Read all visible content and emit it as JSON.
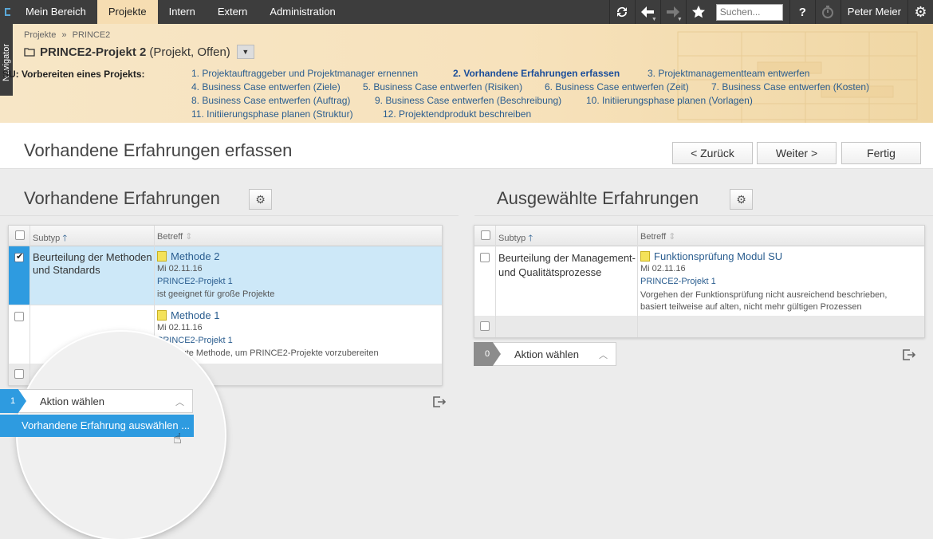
{
  "topbar": {
    "tabs": [
      "Mein Bereich",
      "Projekte",
      "Intern",
      "Extern",
      "Administration"
    ],
    "active_tab": "Projekte",
    "search_placeholder": "Suchen...",
    "help": "?",
    "user": "Peter Meier"
  },
  "navigator": "Navigator",
  "breadcrumb": {
    "a": "Projekte",
    "sep": "»",
    "b": "PRINCE2"
  },
  "project": {
    "name": "PRINCE2-Projekt 2",
    "status": "(Projekt, Offen)"
  },
  "su": {
    "label": "SU: Vorbereiten eines Projekts:",
    "steps": [
      "1. Projektauftraggeber und Projektmanager ernennen",
      "2. Vorhandene Erfahrungen erfassen",
      "3. Projektmanagementteam entwerfen",
      "4. Business Case entwerfen (Ziele)",
      "5. Business Case entwerfen (Risiken)",
      "6. Business Case entwerfen (Zeit)",
      "7. Business Case entwerfen (Kosten)",
      "8. Business Case entwerfen (Auftrag)",
      "9. Business Case entwerfen (Beschreibung)",
      "10. Initiierungsphase planen (Vorlagen)",
      "11. Initiierungsphase planen (Struktur)",
      "12. Projektendprodukt beschreiben"
    ]
  },
  "page": {
    "title": "Vorhandene Erfahrungen erfassen",
    "back": "< Zurück",
    "next": "Weiter >",
    "finish": "Fertig"
  },
  "left": {
    "title": "Vorhandene Erfahrungen",
    "col_subtyp": "Subtyp",
    "col_betreff": "Betreff",
    "rows": [
      {
        "subtyp": "Beurteilung der Methoden und Standards",
        "title": "Methode 2",
        "date": "Mi 02.11.16",
        "project": "PRINCE2-Projekt 1",
        "desc": "ist geeignet für große Projekte"
      },
      {
        "subtyp": "",
        "title": "Methode 1",
        "date": "Mi 02.11.16",
        "project": "PRINCE2-Projekt 1",
        "desc": "sehr gute Methode, um PRINCE2-Projekte vorzubereiten"
      }
    ],
    "count": "1",
    "action": "Aktion wählen",
    "menu_item": "Vorhandene Erfahrung auswählen ..."
  },
  "right": {
    "title": "Ausgewählte Erfahrungen",
    "col_subtyp": "Subtyp",
    "col_betreff": "Betreff",
    "rows": [
      {
        "subtyp": "Beurteilung der Management- und Qualitätsprozesse",
        "title": "Funktionsprüfung Modul SU",
        "date": "Mi 02.11.16",
        "project": "PRINCE2-Projekt 1",
        "desc": "Vorgehen der Funktionsprüfung nicht ausreichend beschrieben, basiert teilweise auf alten, nicht mehr gültigen Prozessen"
      }
    ],
    "count": "0",
    "action": "Aktion wählen"
  },
  "colors": {
    "accent": "#2e9be0",
    "topbar": "#3d3d3d",
    "selected_row": "#cde8f8",
    "link": "#2a5d8f"
  }
}
